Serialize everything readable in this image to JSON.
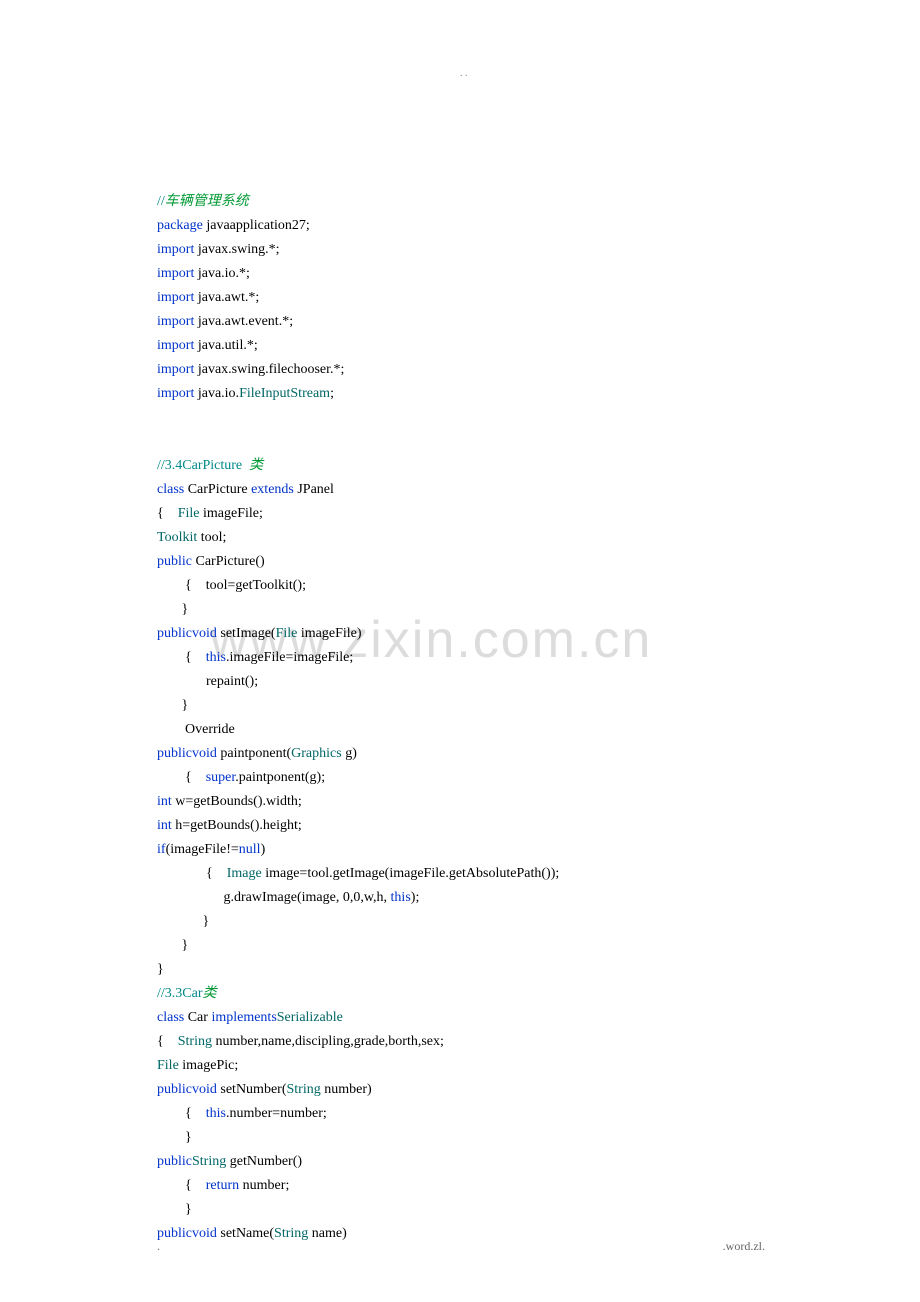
{
  "top_dots": ".\n.",
  "watermark": "www.zixin.com.cn",
  "footer_left": ".",
  "footer_right": ".word.zl.",
  "code": {
    "l01a": "//",
    "l01b": "车辆管理系统",
    "l02a": "package",
    "l02b": " javaapplication27;",
    "l03a": "import",
    "l03b": " javax.swing.*;",
    "l04a": "import",
    "l04b": " java.io.*;",
    "l05a": "import",
    "l05b": " java.awt.*;",
    "l06a": "import",
    "l06b": " java.awt.event.*;",
    "l07a": "import",
    "l07b": " java.util.*;",
    "l08a": "import",
    "l08b": " javax.swing.filechooser.*;",
    "l09a": "import",
    "l09b": " java.io.",
    "l09c": "FileInputStream",
    "l09d": ";",
    "l10": "//3.4CarPicture",
    "l10b": "类",
    "l11a": "class",
    "l11b": " CarPicture ",
    "l11c": "extends",
    "l11d": " JPanel",
    "l12a": "{    ",
    "l12b": "File",
    "l12c": " imageFile;",
    "l13a": "Toolkit",
    "l13b": " tool;",
    "l14a": "public",
    "l14b": " CarPicture()",
    "l15": "        {    tool=getToolkit();",
    "l16": "       }",
    "l17a": "public",
    "l17b": "void",
    "l17c": " setImage(",
    "l17d": "File",
    "l17e": " imageFile)",
    "l18a": "        {    ",
    "l18b": "this",
    "l18c": ".imageFile=imageFile;",
    "l19": "              repaint();",
    "l20": "       }",
    "l21": "        Override",
    "l22a": "public",
    "l22b": "void",
    "l22c": " paintponent(",
    "l22d": "Graphics",
    "l22e": " g)",
    "l23a": "        {    ",
    "l23b": "super",
    "l23c": ".paintponent(g);",
    "l24a": "int",
    "l24b": " w=getBounds().width;",
    "l25a": "int",
    "l25b": " h=getBounds().height;",
    "l26a": "if",
    "l26b": "(imageFile!=",
    "l26c": "null",
    "l26d": ")",
    "l27a": "              {    ",
    "l27b": "Image",
    "l27c": " image=tool.getImage(imageFile.getAbsolutePath());",
    "l28a": "                   g.drawImage(image, 0,0,w,h, ",
    "l28b": "this",
    "l28c": ");",
    "l29": "             }",
    "l30": "       }",
    "l31": "}",
    "l32a": "//3.3Car",
    "l32b": "类",
    "l33a": "class",
    "l33b": " Car ",
    "l33c": "implements",
    "l33d": "Serializable",
    "l34a": "{    ",
    "l34b": "String",
    "l34c": " number,name,discipling,grade,borth,sex;",
    "l35a": "File",
    "l35b": " imagePic;",
    "l36a": "public",
    "l36b": "void",
    "l36c": " setNumber(",
    "l36d": "String",
    "l36e": " number)",
    "l37a": "        {    ",
    "l37b": "this",
    "l37c": ".number=number;",
    "l38": "        }",
    "l39a": "public",
    "l39b": "String",
    "l39c": " getNumber()",
    "l40a": "        {    ",
    "l40b": "return",
    "l40c": " number;",
    "l41": "        }",
    "l42a": "public",
    "l42b": "void",
    "l42c": " setName(",
    "l42d": "String",
    "l42e": " name)"
  }
}
